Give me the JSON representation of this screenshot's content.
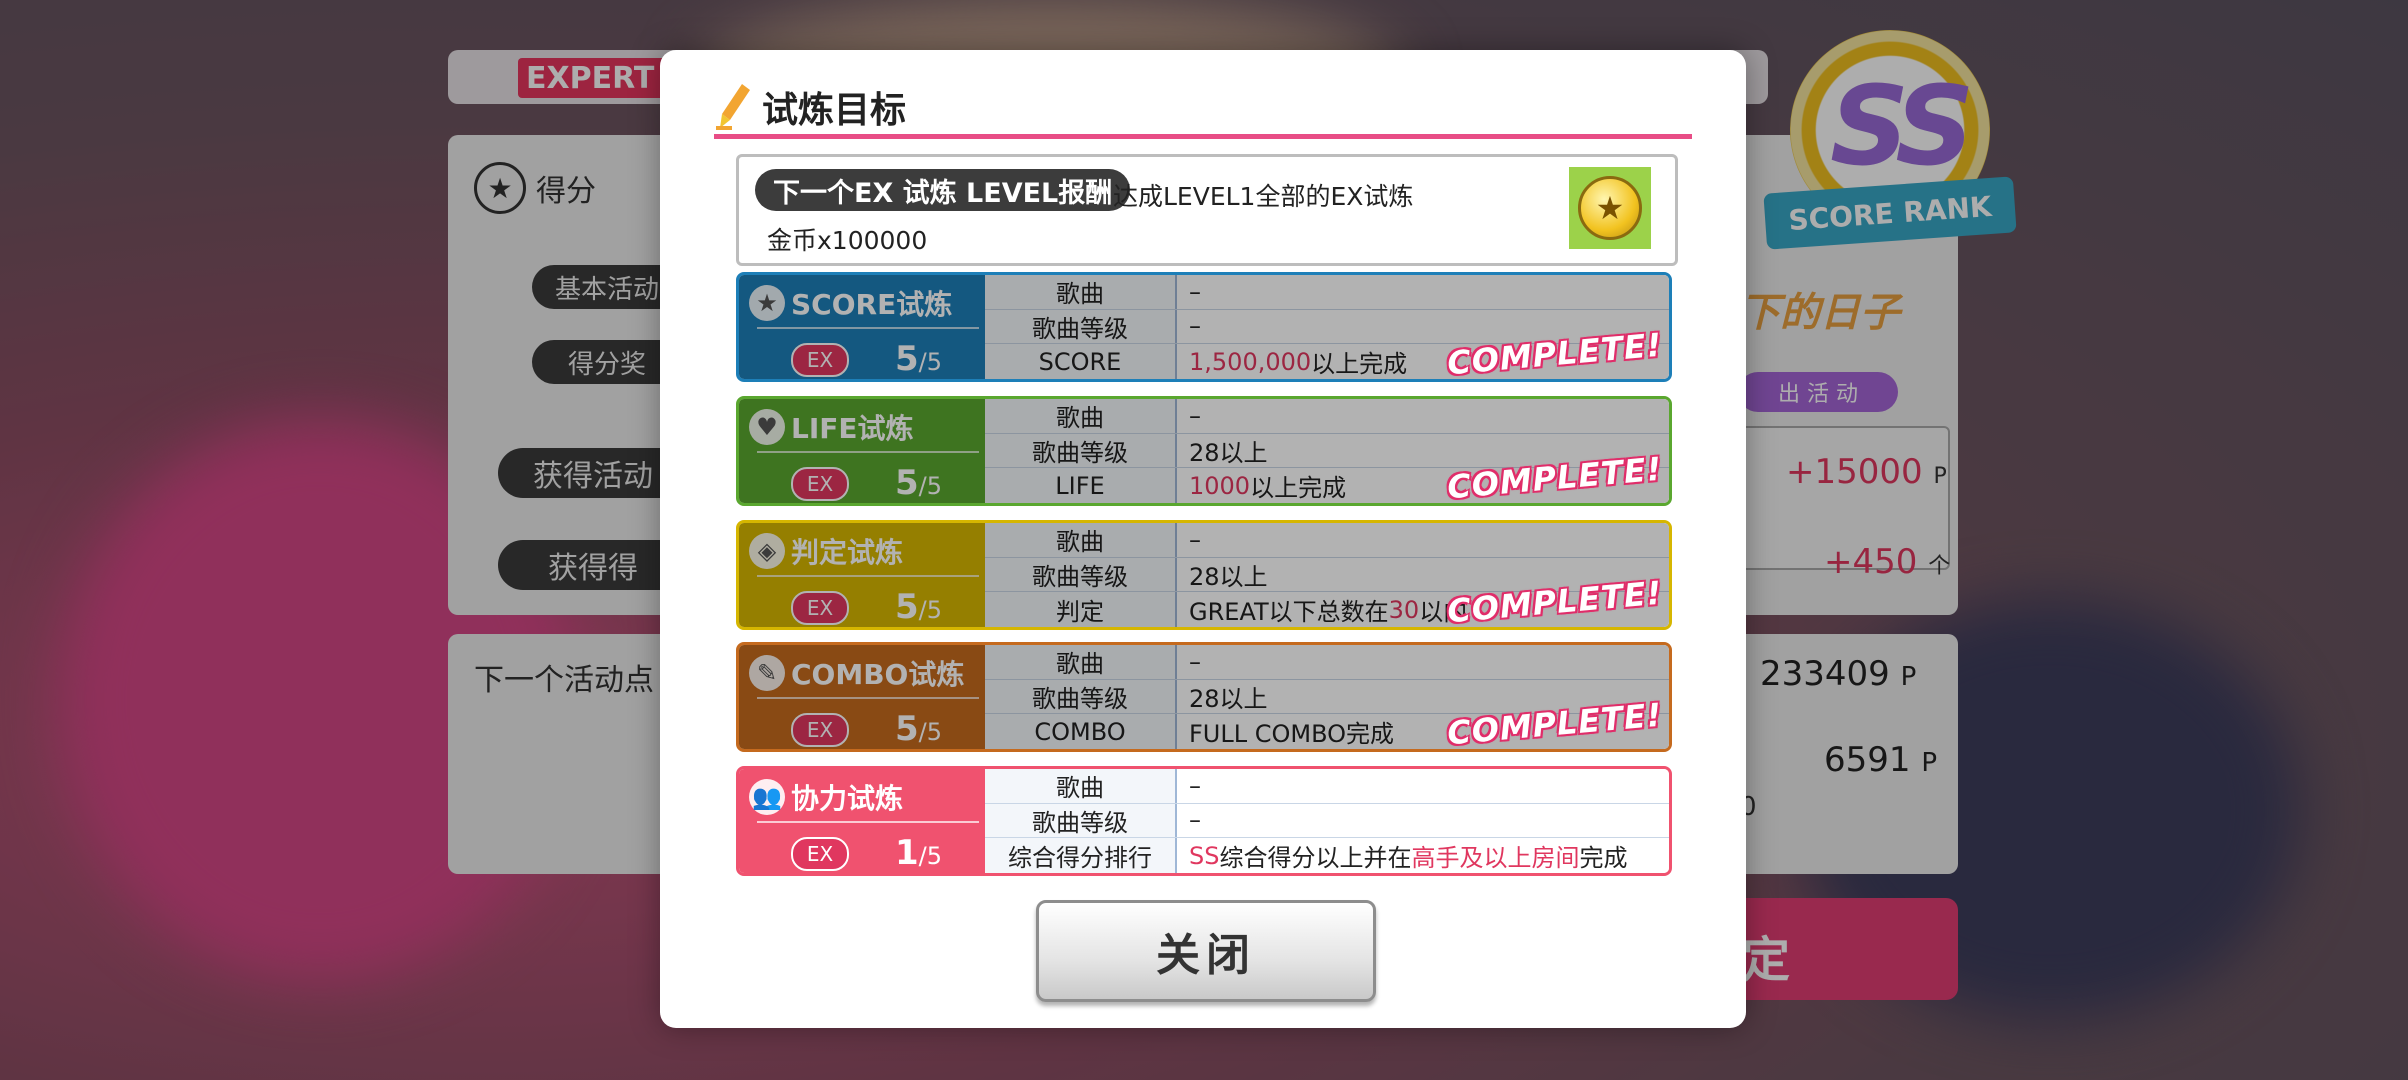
{
  "background": {
    "difficulty": "EXPERT",
    "score_section_label": "得分",
    "basic_activity_label": "基本活动",
    "score_bonus_label": "得分奖",
    "get_activity_label": "获得活动",
    "get_item_label": "获得得",
    "next_activity_label": "下一个活动点",
    "event_points": "+15000",
    "event_points_unit": "P",
    "items_count": "+450",
    "items_unit": "个",
    "total_points": "233409",
    "total_points_unit": "P",
    "next_points": "6591",
    "next_points_unit": "P",
    "next_extra": "0",
    "event_tag": "出 活 动",
    "event_title": "下的日子",
    "rank": "SS",
    "rank_label": "SCORE RANK",
    "confirm_char": "定"
  },
  "modal": {
    "title": "试炼目标",
    "reward": {
      "badge": "下一个EX 试炼 LEVEL报酬",
      "condition": "达成LEVEL1全部的EX试炼",
      "item": "金币x100000"
    },
    "ex_label": "EX",
    "complete_label": "COMPLETE!",
    "row_labels": [
      "歌曲",
      "歌曲等级"
    ],
    "trials": [
      {
        "name": "SCORE试炼",
        "icon": "star-icon",
        "progress": "5",
        "total": "/5",
        "song": "–",
        "level": "–",
        "metric": "SCORE",
        "value_hl": "1,500,000",
        "value_rest": "以上完成",
        "complete": true,
        "color": "#1d7fb8"
      },
      {
        "name": "LIFE试炼",
        "icon": "heart-icon",
        "progress": "5",
        "total": "/5",
        "song": "–",
        "level": "28以上",
        "metric": "LIFE",
        "value_hl": "1000",
        "value_rest": "以上完成",
        "complete": true,
        "color": "#5aa72f"
      },
      {
        "name": "判定试炼",
        "icon": "diamond-icon",
        "progress": "5",
        "total": "/5",
        "song": "–",
        "level": "28以上",
        "metric": "判定",
        "value_pre": "GREAT以下总数在",
        "value_hl": "30",
        "value_rest": "以内",
        "complete": true,
        "color": "#d6b600"
      },
      {
        "name": "COMBO试炼",
        "icon": "pen-icon",
        "progress": "5",
        "total": "/5",
        "song": "–",
        "level": "28以上",
        "metric": "COMBO",
        "value_rest": "FULL COMBO完成",
        "complete": true,
        "color": "#c56a1e"
      },
      {
        "name": "协力试炼",
        "icon": "people-icon",
        "progress": "1",
        "total": "/5",
        "song": "–",
        "level": "–",
        "metric": "综合得分排行",
        "value_hl": "SS",
        "value_mid": "综合得分以上并在",
        "value_hl2": "高手及以上房间",
        "value_rest": "完成",
        "complete": false,
        "color": "#f0526f"
      }
    ],
    "close_label": "关闭"
  }
}
